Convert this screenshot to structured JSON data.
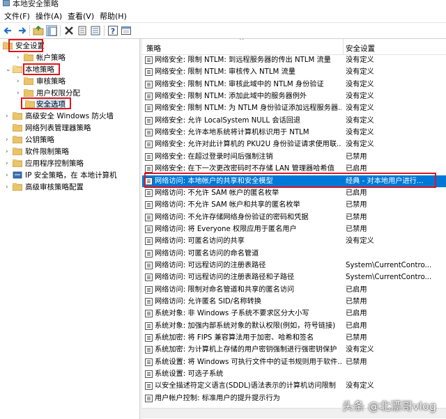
{
  "window": {
    "title": "本地安全策略"
  },
  "menu": [
    "文件(F)",
    "操作(A)",
    "查看(V)",
    "帮助(H)"
  ],
  "toolbar": [
    "back-icon",
    "forward-icon",
    "up-folder-icon",
    "show-tree-icon",
    "delete-icon",
    "properties-icon",
    "export-list-icon",
    "help-icon",
    "console-icon"
  ],
  "tree": [
    {
      "label": "安全设置",
      "level": 0,
      "arrow": "",
      "highlight": true
    },
    {
      "label": "帐户策略",
      "level": 1,
      "arrow": "›"
    },
    {
      "label": "本地策略",
      "level": 1,
      "arrow": "⌄",
      "highlight": true
    },
    {
      "label": "审核策略",
      "level": 2,
      "arrow": "›"
    },
    {
      "label": "用户权限分配",
      "level": 2,
      "arrow": "›"
    },
    {
      "label": "安全选项",
      "level": 2,
      "arrow": "",
      "highlight": true
    },
    {
      "label": "高级安全 Windows 防火墙",
      "level": 1,
      "arrow": "›"
    },
    {
      "label": "网络列表管理器策略",
      "level": 1,
      "arrow": ""
    },
    {
      "label": "公钥策略",
      "level": 1,
      "arrow": "›"
    },
    {
      "label": "软件限制策略",
      "level": 1,
      "arrow": "›"
    },
    {
      "label": "应用程序控制策略",
      "level": 1,
      "arrow": "›"
    },
    {
      "label": "IP 安全策略，在 本地计算机",
      "level": 1,
      "arrow": "›"
    },
    {
      "label": "高级审核策略配置",
      "level": 1,
      "arrow": "›"
    }
  ],
  "list": {
    "headers": [
      "策略",
      "安全设置"
    ],
    "rows": [
      {
        "policy": "网络安全: 限制 NTLM: 到远程服务器的传出 NTLM 流量",
        "setting": "没有定义"
      },
      {
        "policy": "网络安全: 限制 NTLM: 审核传入 NTLM 流量",
        "setting": "没有定义"
      },
      {
        "policy": "网络安全: 限制 NTLM: 审核此域中的 NTLM 身份验证",
        "setting": "没有定义"
      },
      {
        "policy": "网络安全: 限制 NTLM: 添加此域中的服务器例外",
        "setting": "没有定义"
      },
      {
        "policy": "网络安全: 限制 NTLM: 为 NTLM 身份验证添加远程服务器...",
        "setting": "没有定义"
      },
      {
        "policy": "网络安全: 允许 LocalSystem NULL 会话回退",
        "setting": "没有定义"
      },
      {
        "policy": "网络安全: 允许本地系统将计算机标识用于 NTLM",
        "setting": "没有定义"
      },
      {
        "policy": "网络安全: 允许对此计算机的 PKU2U 身份验证请求使用联...",
        "setting": "没有定义"
      },
      {
        "policy": "网络安全: 在超过登录时间后强制注销",
        "setting": "已禁用"
      },
      {
        "policy": "网络安全: 在下一次更改密码时不存储 LAN 管理器哈希值",
        "setting": "已启用"
      },
      {
        "policy": "网络访问: 本地帐户的共享和安全模型",
        "setting": "经典 - 对本地用户进行...",
        "selected": true
      },
      {
        "policy": "网络访问: 不允许 SAM 帐户的匿名枚举",
        "setting": "已启用"
      },
      {
        "policy": "网络访问: 不允许 SAM 帐户和共享的匿名枚举",
        "setting": "已禁用"
      },
      {
        "policy": "网络访问: 不允许存储网络身份验证的密码和凭据",
        "setting": "已禁用"
      },
      {
        "policy": "网络访问: 将 Everyone 权限应用于匿名用户",
        "setting": "已禁用"
      },
      {
        "policy": "网络访问: 可匿名访问的共享",
        "setting": "没有定义"
      },
      {
        "policy": "网络访问: 可匿名访问的命名管道",
        "setting": ""
      },
      {
        "policy": "网络访问: 可远程访问的注册表路径",
        "setting": "System\\CurrentContro..."
      },
      {
        "policy": "网络访问: 可远程访问的注册表路径和子路径",
        "setting": "System\\CurrentContro..."
      },
      {
        "policy": "网络访问: 限制对命名管道和共享的匿名访问",
        "setting": "已启用"
      },
      {
        "policy": "网络访问: 允许匿名 SID/名称转换",
        "setting": "已禁用"
      },
      {
        "policy": "系统对象: 非 Windows 子系统不要求区分大小写",
        "setting": "已启用"
      },
      {
        "policy": "系统对象: 加强内部系统对象的默认权限(例如，符号链接)",
        "setting": "已启用"
      },
      {
        "policy": "系统加密: 将 FIPS 兼容算法用于加密、哈希和签名",
        "setting": "已禁用"
      },
      {
        "policy": "系统加密: 为计算机上存储的用户密钥强制进行强密钥保护",
        "setting": "没有定义"
      },
      {
        "policy": "系统设置: 将 Windows 可执行文件中的证书规则用于软件...",
        "setting": "已禁用"
      },
      {
        "policy": "系统设置: 可选子系统",
        "setting": ""
      },
      {
        "policy": "以安全描述符定义语言(SDDL)语法表示的计算机访问限制",
        "setting": "没有定义"
      },
      {
        "policy": "用户帐户控制: 标准用户的提升提示行为",
        "setting": ""
      }
    ]
  },
  "watermark": "头条 @北漂哥vlog"
}
